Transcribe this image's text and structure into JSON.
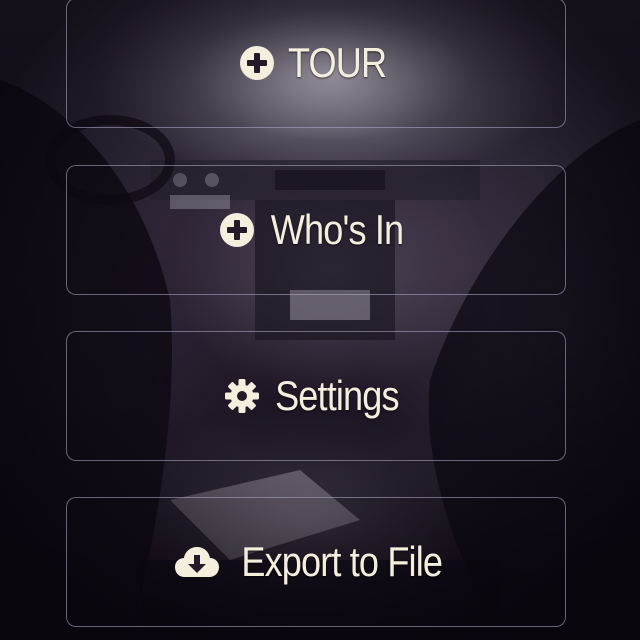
{
  "menu": {
    "items": [
      {
        "label": "TOUR",
        "icon": "plus-circle-icon"
      },
      {
        "label": "Who's In",
        "icon": "plus-circle-icon"
      },
      {
        "label": "Settings",
        "icon": "gear-icon"
      },
      {
        "label": "Export to File",
        "icon": "cloud-download-icon"
      }
    ]
  },
  "colors": {
    "text": "#f4efdd",
    "border": "#b4b0cd"
  }
}
